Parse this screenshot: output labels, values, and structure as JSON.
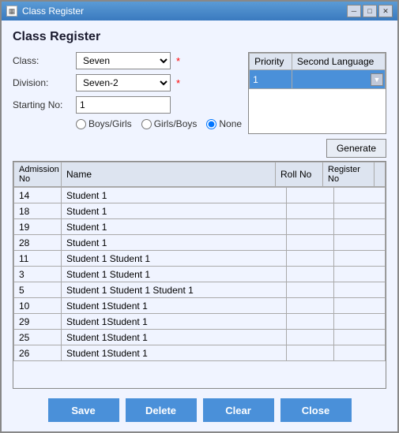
{
  "window": {
    "title": "Class Register",
    "controls": {
      "minimize": "─",
      "maximize": "□",
      "close": "✕"
    }
  },
  "page": {
    "title": "Class Register"
  },
  "form": {
    "class_label": "Class:",
    "class_value": "Seven",
    "division_label": "Division:",
    "division_value": "Seven-2",
    "starting_no_label": "Starting No:",
    "starting_no_value": "1",
    "radio_boys_girls": "Boys/Girls",
    "radio_girls_boys": "Girls/Boys",
    "radio_none": "None",
    "radio_selected": "None"
  },
  "priority_table": {
    "col_priority": "Priority",
    "col_second_language": "Second Language",
    "rows": [
      {
        "priority": "1",
        "language": ""
      }
    ]
  },
  "generate_button": "Generate",
  "data_table": {
    "columns": [
      {
        "id": "admission_no",
        "label": "Admission\nNo"
      },
      {
        "id": "name",
        "label": "Name"
      },
      {
        "id": "roll_no",
        "label": "Roll No"
      },
      {
        "id": "register_no",
        "label": "Register\nNo"
      }
    ],
    "rows": [
      {
        "admission_no": "14",
        "name": "Student 1",
        "roll_no": "",
        "register_no": ""
      },
      {
        "admission_no": "18",
        "name": "Student 1",
        "roll_no": "",
        "register_no": ""
      },
      {
        "admission_no": "19",
        "name": "Student 1",
        "roll_no": "",
        "register_no": ""
      },
      {
        "admission_no": "28",
        "name": "Student 1",
        "roll_no": "",
        "register_no": ""
      },
      {
        "admission_no": "11",
        "name": "Student 1  Student 1",
        "roll_no": "",
        "register_no": ""
      },
      {
        "admission_no": "3",
        "name": "Student 1  Student 1",
        "roll_no": "",
        "register_no": ""
      },
      {
        "admission_no": "5",
        "name": "Student 1 Student 1 Student 1",
        "roll_no": "",
        "register_no": ""
      },
      {
        "admission_no": "10",
        "name": "Student 1Student 1",
        "roll_no": "",
        "register_no": ""
      },
      {
        "admission_no": "29",
        "name": "Student 1Student 1",
        "roll_no": "",
        "register_no": ""
      },
      {
        "admission_no": "25",
        "name": "Student 1Student 1",
        "roll_no": "",
        "register_no": ""
      },
      {
        "admission_no": "26",
        "name": "Student 1Student 1",
        "roll_no": "",
        "register_no": ""
      }
    ]
  },
  "buttons": {
    "save": "Save",
    "delete": "Delete",
    "clear": "Clear",
    "close": "Close"
  }
}
